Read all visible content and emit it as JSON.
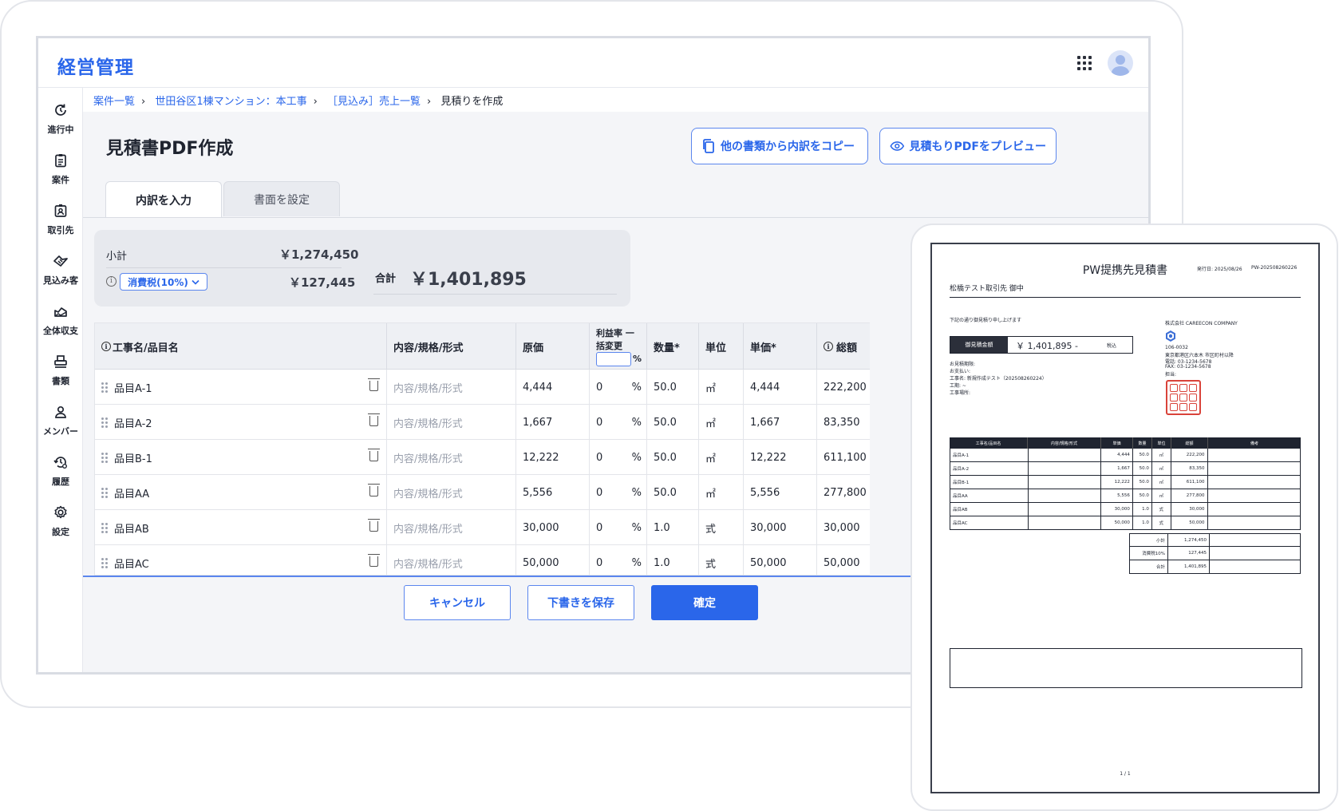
{
  "app": {
    "logo": "経営管理"
  },
  "sidebar": {
    "items": [
      {
        "label": "進行中",
        "icon": "progress-icon"
      },
      {
        "label": "案件",
        "icon": "clipboard-icon"
      },
      {
        "label": "取引先",
        "icon": "contact-badge-icon"
      },
      {
        "label": "見込み客",
        "icon": "handshake-icon"
      },
      {
        "label": "全体収支",
        "icon": "chart-area-icon"
      },
      {
        "label": "書類",
        "icon": "printer-icon"
      },
      {
        "label": "メンバー",
        "icon": "person-icon"
      },
      {
        "label": "履歴",
        "icon": "history-icon"
      },
      {
        "label": "設定",
        "icon": "gear-icon"
      }
    ]
  },
  "breadcrumb": {
    "items": [
      "案件一覧",
      "世田谷区1棟マンション：本工事",
      "［見込み］売上一覧"
    ],
    "current": "見積りを作成"
  },
  "page": {
    "title": "見積書PDF作成",
    "copy_button": "他の書類から内訳をコピー",
    "preview_button": "見積もりPDFをプレビュー"
  },
  "tabs": [
    {
      "label": "内訳を入力",
      "active": true
    },
    {
      "label": "書面を設定",
      "active": false
    }
  ],
  "summary": {
    "subtotal_label": "小計",
    "subtotal_value": "￥1,274,450",
    "tax_select": "消費税(10%)",
    "tax_value": "￥127,445",
    "total_label": "合計",
    "total_value": "￥1,401,895"
  },
  "table": {
    "headers": {
      "name": "工事名/品目名",
      "spec": "内容/規格/形式",
      "cost": "原価",
      "profit_line1": "利益率 一",
      "profit_line2": "括変更",
      "profit_unit": "%",
      "qty": "数量*",
      "unit": "単位",
      "price": "単価*",
      "total": "総額"
    },
    "spec_placeholder": "内容/規格/形式",
    "rows": [
      {
        "name": "品目A-1",
        "cost": "4,444",
        "profit": "0",
        "qty": "50.0",
        "unit": "㎡",
        "price": "4,444",
        "total": "222,200"
      },
      {
        "name": "品目A-2",
        "cost": "1,667",
        "profit": "0",
        "qty": "50.0",
        "unit": "㎡",
        "price": "1,667",
        "total": "83,350"
      },
      {
        "name": "品目B-1",
        "cost": "12,222",
        "profit": "0",
        "qty": "50.0",
        "unit": "㎡",
        "price": "12,222",
        "total": "611,100"
      },
      {
        "name": "品目AA",
        "cost": "5,556",
        "profit": "0",
        "qty": "50.0",
        "unit": "㎡",
        "price": "5,556",
        "total": "277,800"
      },
      {
        "name": "品目AB",
        "cost": "30,000",
        "profit": "0",
        "qty": "1.0",
        "unit": "式",
        "price": "30,000",
        "total": "30,000"
      },
      {
        "name": "品目AC",
        "cost": "50,000",
        "profit": "0",
        "qty": "1.0",
        "unit": "式",
        "price": "50,000",
        "total": "50,000"
      }
    ],
    "percent": "%"
  },
  "footer": {
    "cancel": "キャンセル",
    "save_draft": "下書きを保存",
    "confirm": "確定"
  },
  "pdf": {
    "title": "PW提携先見積書",
    "issue_date": "発行日: 2025/08/26",
    "doc_no": "PW-202508260226",
    "recipient": "松橋テスト取引先 御中",
    "greeting": "下記の通り御見積り申し上げます",
    "amount_label": "御見積金額",
    "amount_value": "￥ 1,401,895 -",
    "amount_tax": "税込",
    "details": [
      "お見積期限:",
      "お支払い:",
      "工事名: 新規作成テスト（202508260224）",
      "工期: ~",
      "工事場所:"
    ],
    "company": {
      "name": "株式会社 CAREECON COMPANY",
      "postal": "106-0032",
      "address": "東京都港区六本木 市区町村以降",
      "tel": "電話: 03-1234-5678",
      "fax": "FAX: 03-1234-5678",
      "contact": "担当:"
    },
    "table_headers": [
      "工事名/品目名",
      "内容/規格/形式",
      "単価",
      "数量",
      "単位",
      "総額",
      "備考"
    ],
    "rows": [
      {
        "name": "品目A-1",
        "price": "4,444",
        "qty": "50.0",
        "unit": "㎡",
        "total": "222,200"
      },
      {
        "name": "品目A-2",
        "price": "1,667",
        "qty": "50.0",
        "unit": "㎡",
        "total": "83,350"
      },
      {
        "name": "品目B-1",
        "price": "12,222",
        "qty": "50.0",
        "unit": "㎡",
        "total": "611,100"
      },
      {
        "name": "品目AA",
        "price": "5,556",
        "qty": "50.0",
        "unit": "㎡",
        "total": "277,800"
      },
      {
        "name": "品目AB",
        "price": "30,000",
        "qty": "1.0",
        "unit": "式",
        "total": "30,000"
      },
      {
        "name": "品目AC",
        "price": "50,000",
        "qty": "1.0",
        "unit": "式",
        "total": "50,000"
      }
    ],
    "totals": [
      {
        "label": "小計",
        "value": "1,274,450"
      },
      {
        "label": "消費税10%",
        "value": "127,445"
      },
      {
        "label": "合計",
        "value": "1,401,895"
      }
    ],
    "page": "1 / 1"
  },
  "colors": {
    "accent": "#2a66ea",
    "stamp": "#d9433a"
  }
}
